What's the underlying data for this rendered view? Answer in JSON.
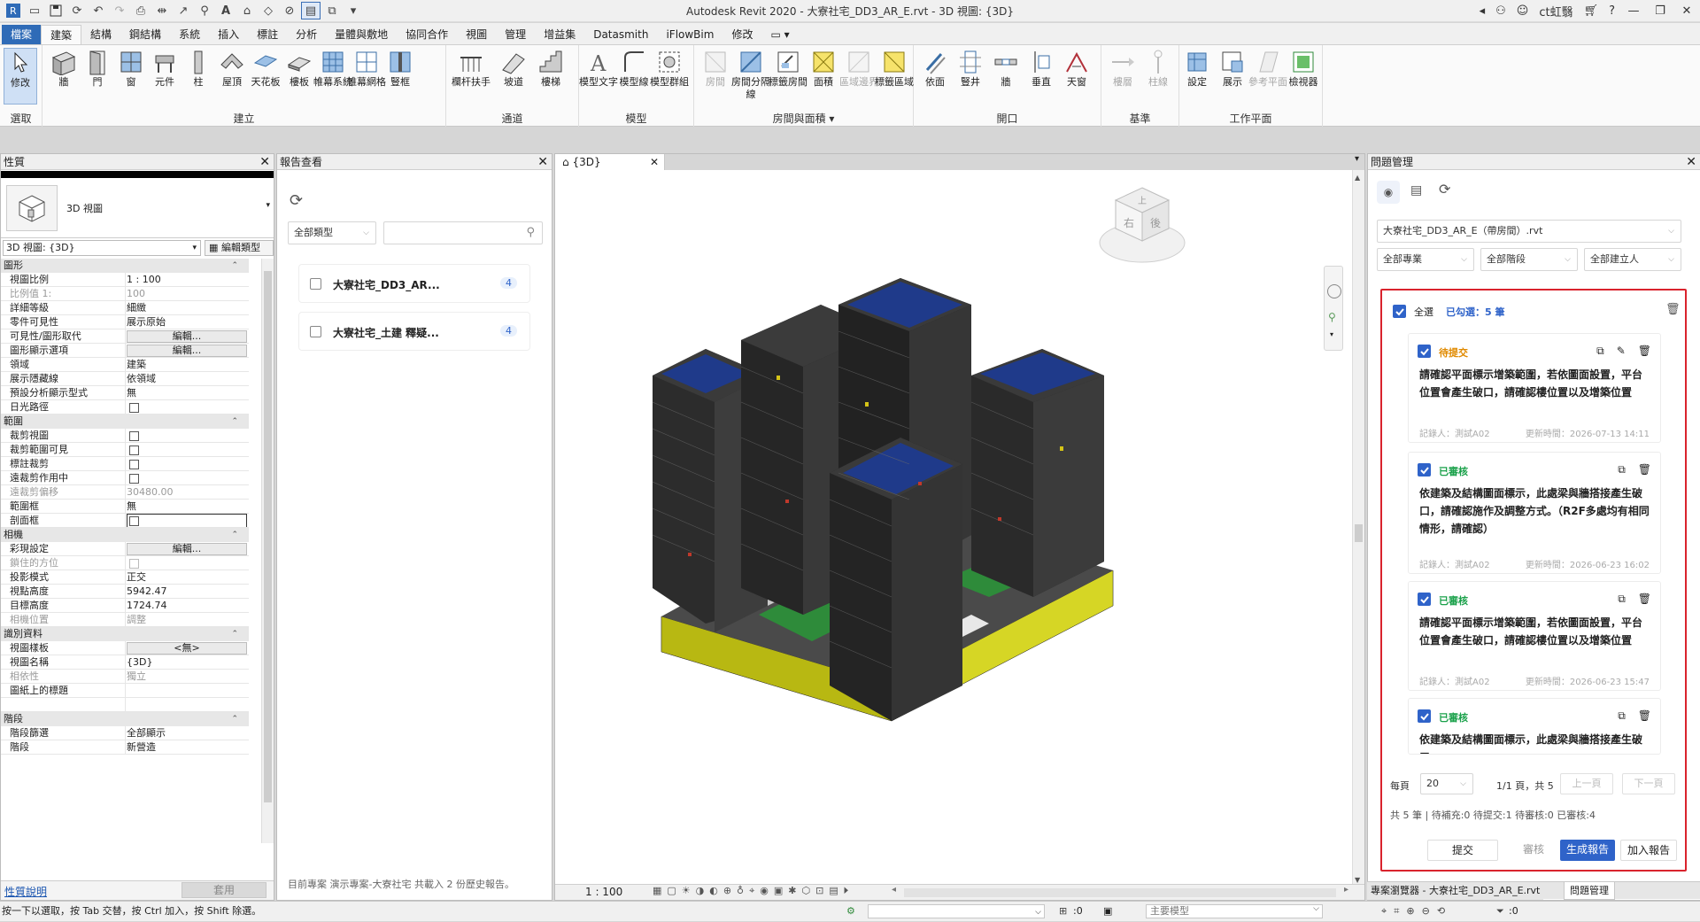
{
  "app_title": "Autodesk Revit 2020 - 大寮社宅_DD3_AR_E.rvt - 3D 視圖: {3D}",
  "user": "ct虹翳",
  "ribbon_tabs": [
    "檔案",
    "建築",
    "結構",
    "鋼結構",
    "系統",
    "插入",
    "標註",
    "分析",
    "量體與敷地",
    "協同合作",
    "視圖",
    "管理",
    "增益集",
    "Datasmith",
    "iFlowBim",
    "修改"
  ],
  "ribbon": {
    "modify": "修改",
    "select": "選取",
    "build_items": [
      "牆",
      "門",
      "窗",
      "元件",
      "柱",
      "屋頂",
      "天花板",
      "樓板",
      "帷幕系統",
      "帷幕網格",
      "豎框"
    ],
    "build_label": "建立",
    "circulation_items": [
      "欄杆扶手",
      "坡道",
      "樓梯"
    ],
    "circulation_label": "通道",
    "model_items": [
      "模型文字",
      "模型線",
      "模型群組"
    ],
    "model_label": "模型",
    "room_items": [
      "房間",
      "房間分隔線",
      "標籤房間",
      "面積",
      "區域邊界",
      "標籤區域"
    ],
    "room_label": "房間與面積",
    "opening_items": [
      "依面",
      "豎井",
      "牆",
      "垂直",
      "天窗"
    ],
    "opening_label": "開口",
    "datum_items": [
      "樓層",
      "柱線"
    ],
    "datum_label": "基準",
    "workplane_items": [
      "設定",
      "展示",
      "參考平面",
      "檢視器"
    ],
    "workplane_label": "工作平面"
  },
  "properties": {
    "title": "性質",
    "type_name": "3D 視圖",
    "view_selector": "3D 視圖: {3D}",
    "edit_type": "編輯類型",
    "sections": {
      "graphics": "圖形",
      "extents": "範圍",
      "camera": "相機",
      "identity": "識別資料",
      "phasing": "階段"
    },
    "rows": {
      "view_scale": [
        "視圖比例",
        "1 : 100"
      ],
      "scale_value": [
        "比例值 1:",
        "100"
      ],
      "detail_level": [
        "詳細等級",
        "細緻"
      ],
      "parts_visibility": [
        "零件可見性",
        "展示原始"
      ],
      "vg_overrides": [
        "可見性/圖形取代",
        "編輯..."
      ],
      "graphic_display": [
        "圖形顯示選項",
        "編輯..."
      ],
      "discipline": [
        "領域",
        "建築"
      ],
      "show_hidden": [
        "展示隱藏線",
        "依領域"
      ],
      "analysis_display": [
        "預設分析顯示型式",
        "無"
      ],
      "sun_path": [
        "日光路徑",
        ""
      ],
      "crop_view": [
        "裁剪視圖",
        ""
      ],
      "crop_visible": [
        "裁剪範圍可見",
        ""
      ],
      "annotation_crop": [
        "標註裁剪",
        ""
      ],
      "far_clip_active": [
        "遠裁剪作用中",
        ""
      ],
      "far_clip_offset": [
        "遠裁剪偏移",
        "30480.00"
      ],
      "scope_box": [
        "範圍框",
        "無"
      ],
      "section_box": [
        "剖面框",
        ""
      ],
      "render_settings": [
        "彩現設定",
        "編輯..."
      ],
      "locked_orientation": [
        "鎖住的方位",
        ""
      ],
      "projection_mode": [
        "投影模式",
        "正交"
      ],
      "eye_elevation": [
        "視點高度",
        "5942.47"
      ],
      "target_elevation": [
        "目標高度",
        "1724.74"
      ],
      "camera_position": [
        "相機位置",
        "調整"
      ],
      "view_template": [
        "視圖樣板",
        "<無>"
      ],
      "view_name": [
        "視圖名稱",
        "{3D}"
      ],
      "dependency": [
        "相依性",
        "獨立"
      ],
      "title_on_sheet": [
        "圖紙上的標題",
        ""
      ],
      "phase_filter": [
        "階段篩選",
        "全部顯示"
      ],
      "phase": [
        "階段",
        "新營造"
      ]
    },
    "help_link": "性質說明",
    "apply": "套用"
  },
  "report_panel": {
    "title": "報告查看",
    "type_filter": "全部類型",
    "search_placeholder": "",
    "items": [
      {
        "name": "大寮社宅_DD3_AR...",
        "count": "4"
      },
      {
        "name": "大寮社宅_土建 釋疑...",
        "count": "4"
      }
    ],
    "footer": "目前專案 演示專案-大寮社宅 共載入 2 份歷史報告。"
  },
  "view": {
    "tab": "{3D}",
    "scale": "1 : 100",
    "viewcube_labels": [
      "上",
      "右",
      "後"
    ]
  },
  "issue_panel": {
    "title": "問題管理",
    "file_select": "大寮社宅_DD3_AR_E（帶房間）.rvt",
    "filter_project": "全部專業",
    "filter_stage": "全部階段",
    "filter_creator": "全部建立人",
    "select_all": "全選",
    "selected_count": "已勾選：5 筆",
    "issues": [
      {
        "status": "待提交",
        "status_color": "#e08a00",
        "desc": "請確認平面標示增築範圍，若依圖面設置，平台位置會產生破口，請確認樓位置以及增築位置",
        "recorder": "記錄人：測試A02",
        "updated": "更新時間：2026-07-13 14:11"
      },
      {
        "status": "已審核",
        "status_color": "#1aa14a",
        "desc": "依建築及結構圖面標示，此處梁與牆搭接產生破口，請確認施作及調整方式。（R2F多處均有相同情形，請確認）",
        "recorder": "記錄人：測試A02",
        "updated": "更新時間：2026-06-23 16:02"
      },
      {
        "status": "已審核",
        "status_color": "#1aa14a",
        "desc": "請確認平面標示增築範圍，若依圖面設置，平台位置會產生破口，請確認樓位置以及增築位置",
        "recorder": "記錄人：測試A02",
        "updated": "更新時間：2026-06-23 15:47"
      },
      {
        "status": "已審核",
        "status_color": "#1aa14a",
        "desc": "依建築及結構圖面標示，此處梁與牆搭接產生破口，",
        "recorder": "",
        "updated": ""
      }
    ],
    "per_page_label": "每頁",
    "per_page": "20",
    "page_info": "1/1 頁，共 5",
    "prev": "上一頁",
    "next": "下一頁",
    "summary": "共 5 筆 | 待補充:0 待提交:1 待審核:0 已審核:4",
    "btn_submit": "提交",
    "btn_review": "審核",
    "btn_generate": "生成報告",
    "btn_add": "加入報告",
    "bottom_tabs": [
      "專案瀏覽器 - 大寮社宅_DD3_AR_E.rvt",
      "問題管理"
    ]
  },
  "status": {
    "hint": "按一下以選取，按 Tab 交替，按 Ctrl 加入，按 Shift 除選。",
    "model": "主要模型",
    "zero1": ":0",
    "zero2": ":0"
  },
  "colors": {
    "accent": "#2f63c9",
    "highlight_border": "#d9232d",
    "file_tab": "#2f6bb7",
    "pending": "#e08a00",
    "approved": "#1aa14a"
  }
}
